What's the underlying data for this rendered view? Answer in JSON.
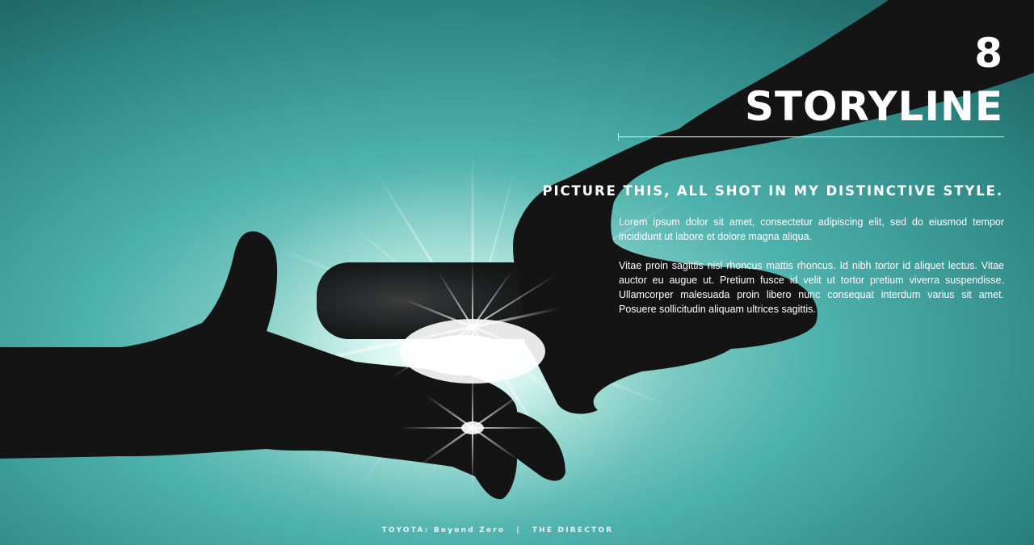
{
  "slide": {
    "number": "8",
    "title": "STORYLINE",
    "subheading": "PICTURE THIS, ALL SHOT IN MY DISTINCTIVE STYLE.",
    "paragraphs": [
      "Lorem ipsum dolor sit amet, consectetur adipiscing elit, sed do eiusmod tempor incididunt ut labore et dolore magna aliqua.",
      "Vitae proin sagittis nisl rhoncus mattis rhoncus. Id nibh tortor id aliquet lectus. Vitae auctor eu augue ut. Pretium fusce id velit ut tortor pretium viverra suspendisse. Ullamcorper malesuada proin libero nunc consequat interdum varius sit amet. Posuere sollicitudin aliquam ultrices sagittis."
    ]
  },
  "footer": {
    "project": "TOYOTA: Beyond Zero",
    "separator": "|",
    "role": "THE DIRECTOR"
  },
  "colors": {
    "background": "#3b9a98",
    "silhouette": "#141414",
    "text": "#ffffff"
  }
}
